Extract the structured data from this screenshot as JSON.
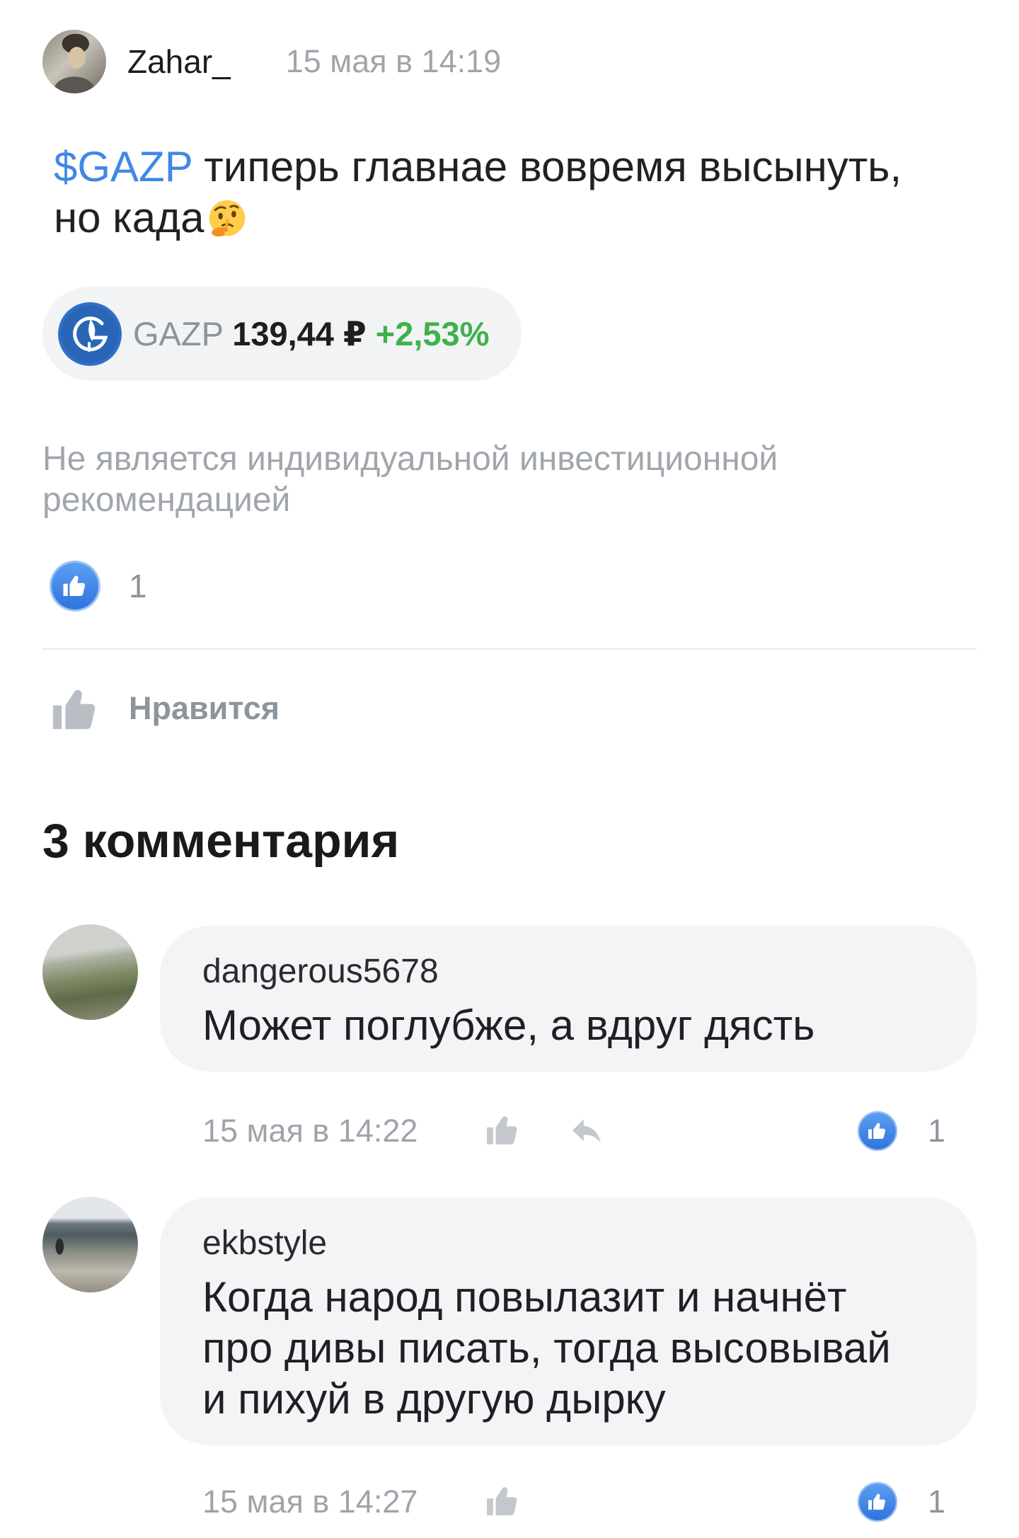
{
  "post": {
    "author": "Zahar_",
    "avatar_icon": "author-avatar",
    "timestamp": "15 мая в 14:19",
    "ticker_tag": "$GAZP",
    "body": "типерь главнае вовремя высынуть, но када",
    "body_emoji_icon": "thinking-face-emoji-icon",
    "instrument": {
      "icon": "gazprom-logo-icon",
      "ticker": "GAZP",
      "price": "139,44 ₽",
      "change": "+2,53%"
    },
    "disclaimer": "Не является индивидуальной инвестиционной рекомендацией",
    "reactions": {
      "icon": "like-reaction-icon",
      "count": "1"
    },
    "like_button": {
      "icon": "thumb-up-icon",
      "label": "Нравится"
    }
  },
  "comments": {
    "title": "3 комментария",
    "items": [
      {
        "author": "dangerous5678",
        "text": "Может поглубже, а вдруг дясть",
        "timestamp": "15 мая в 14:22",
        "actions": [
          "thumb-up-icon",
          "reply-icon"
        ],
        "likes": "1"
      },
      {
        "author": "ekbstyle",
        "text": "Когда народ повылазит и начнёт про дивы писать, тогда высовывай и пихуй в другую дырку",
        "timestamp": "15 мая в 14:27",
        "actions": [
          "thumb-up-icon"
        ],
        "likes": "1"
      }
    ]
  },
  "colors": {
    "accent_blue": "#4188e4",
    "positive_green": "#3fb14b",
    "muted_text": "#a0a5ac",
    "bubble_bg": "#f3f4f6",
    "pill_bg": "#f2f3f5",
    "text": "#1f2023"
  }
}
